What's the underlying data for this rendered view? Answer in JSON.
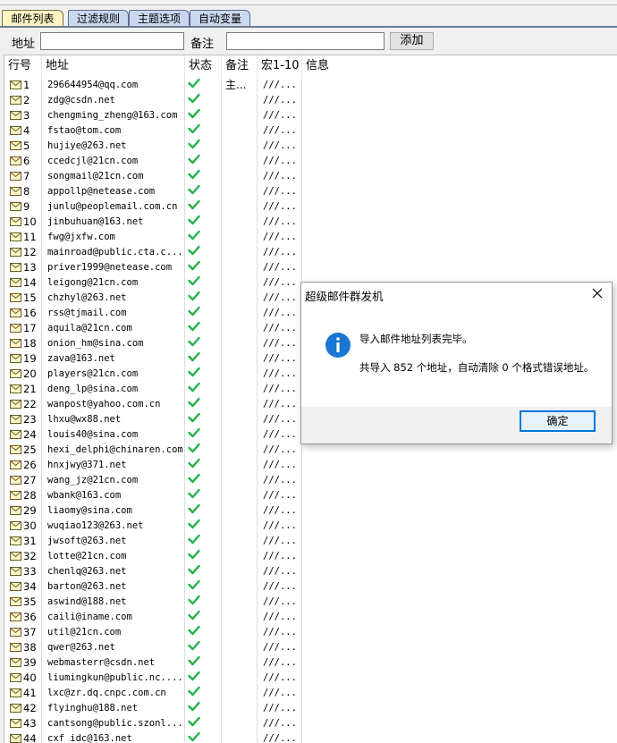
{
  "tabs": [
    {
      "label": "邮件列表",
      "active": true
    },
    {
      "label": "过滤规则",
      "active": false
    },
    {
      "label": "主题选项",
      "active": false
    },
    {
      "label": "自动变量",
      "active": false
    }
  ],
  "addr_bar": {
    "address_label": "地址",
    "address_value": "",
    "note_label": "备注",
    "note_value": "",
    "add_button": "添加"
  },
  "columns": [
    "行号",
    "地址",
    "状态",
    "备注",
    "宏1-10",
    "信息"
  ],
  "rows": [
    {
      "no": "1",
      "address": "296644954@qq.com",
      "note": "主...",
      "macro": "///..."
    },
    {
      "no": "2",
      "address": "zdg@csdn.net",
      "note": "",
      "macro": "///..."
    },
    {
      "no": "3",
      "address": "chengming_zheng@163.com",
      "note": "",
      "macro": "///..."
    },
    {
      "no": "4",
      "address": "fstao@tom.com",
      "note": "",
      "macro": "///..."
    },
    {
      "no": "5",
      "address": "hujiye@263.net",
      "note": "",
      "macro": "///..."
    },
    {
      "no": "6",
      "address": "ccedcjl@21cn.com",
      "note": "",
      "macro": "///..."
    },
    {
      "no": "7",
      "address": "songmail@21cn.com",
      "note": "",
      "macro": "///..."
    },
    {
      "no": "8",
      "address": "appollp@netease.com",
      "note": "",
      "macro": "///..."
    },
    {
      "no": "9",
      "address": "junlu@peoplemail.com.cn",
      "note": "",
      "macro": "///..."
    },
    {
      "no": "10",
      "address": "jinbuhuan@163.net",
      "note": "",
      "macro": "///..."
    },
    {
      "no": "11",
      "address": "fwg@jxfw.com",
      "note": "",
      "macro": "///..."
    },
    {
      "no": "12",
      "address": "mainroad@public.cta.c...",
      "note": "",
      "macro": "///..."
    },
    {
      "no": "13",
      "address": "priver1999@netease.com",
      "note": "",
      "macro": "///..."
    },
    {
      "no": "14",
      "address": "leigong@21cn.com",
      "note": "",
      "macro": "///..."
    },
    {
      "no": "15",
      "address": "chzhyl@263.net",
      "note": "",
      "macro": "///..."
    },
    {
      "no": "16",
      "address": "rss@tjmail.com",
      "note": "",
      "macro": "///..."
    },
    {
      "no": "17",
      "address": "aquila@21cn.com",
      "note": "",
      "macro": "///..."
    },
    {
      "no": "18",
      "address": "onion_hm@sina.com",
      "note": "",
      "macro": "///..."
    },
    {
      "no": "19",
      "address": "zava@163.net",
      "note": "",
      "macro": "///..."
    },
    {
      "no": "20",
      "address": "players@21cn.com",
      "note": "",
      "macro": "///..."
    },
    {
      "no": "21",
      "address": "deng_lp@sina.com",
      "note": "",
      "macro": "///..."
    },
    {
      "no": "22",
      "address": "wanpost@yahoo.com.cn",
      "note": "",
      "macro": "///..."
    },
    {
      "no": "23",
      "address": "lhxu@wx88.net",
      "note": "",
      "macro": "///..."
    },
    {
      "no": "24",
      "address": "louis40@sina.com",
      "note": "",
      "macro": "///..."
    },
    {
      "no": "25",
      "address": "hexi_delphi@chinaren.com",
      "note": "",
      "macro": "///..."
    },
    {
      "no": "26",
      "address": "hnxjwy@371.net",
      "note": "",
      "macro": "///..."
    },
    {
      "no": "27",
      "address": "wang_jz@21cn.com",
      "note": "",
      "macro": "///..."
    },
    {
      "no": "28",
      "address": "wbank@163.com",
      "note": "",
      "macro": "///..."
    },
    {
      "no": "29",
      "address": "liaomy@sina.com",
      "note": "",
      "macro": "///..."
    },
    {
      "no": "30",
      "address": "wuqiao123@263.net",
      "note": "",
      "macro": "///..."
    },
    {
      "no": "31",
      "address": "jwsoft@263.net",
      "note": "",
      "macro": "///..."
    },
    {
      "no": "32",
      "address": "lotte@21cn.com",
      "note": "",
      "macro": "///..."
    },
    {
      "no": "33",
      "address": "chenlq@263.net",
      "note": "",
      "macro": "///..."
    },
    {
      "no": "34",
      "address": "barton@263.net",
      "note": "",
      "macro": "///..."
    },
    {
      "no": "35",
      "address": "aswind@188.net",
      "note": "",
      "macro": "///..."
    },
    {
      "no": "36",
      "address": "caili@iname.com",
      "note": "",
      "macro": "///..."
    },
    {
      "no": "37",
      "address": "util@21cn.com",
      "note": "",
      "macro": "///..."
    },
    {
      "no": "38",
      "address": "qwer@263.net",
      "note": "",
      "macro": "///..."
    },
    {
      "no": "39",
      "address": "webmasterr@csdn.net",
      "note": "",
      "macro": "///..."
    },
    {
      "no": "40",
      "address": "liumingkun@public.nc....",
      "note": "",
      "macro": "///..."
    },
    {
      "no": "41",
      "address": "lxc@zr.dq.cnpc.com.cn",
      "note": "",
      "macro": "///..."
    },
    {
      "no": "42",
      "address": "flyinghu@188.net",
      "note": "",
      "macro": "///..."
    },
    {
      "no": "43",
      "address": "cantsong@public.szonl...",
      "note": "",
      "macro": "///..."
    },
    {
      "no": "44",
      "address": "cxf idc@163.net",
      "note": "",
      "macro": "///..."
    }
  ],
  "dialog": {
    "title": "超级邮件群发机",
    "message_line1": "导入邮件地址列表完毕。",
    "message_line2": "共导入 852 个地址，自动清除 0 个格式错误地址。",
    "ok_button": "确定",
    "icon": "info-icon"
  },
  "colors": {
    "status_check": "#22b14c",
    "active_tab": "#fdf6c4",
    "inactive_tab": "#c9d7ef",
    "info_icon": "#1976d2",
    "ok_border": "#0078d7"
  }
}
